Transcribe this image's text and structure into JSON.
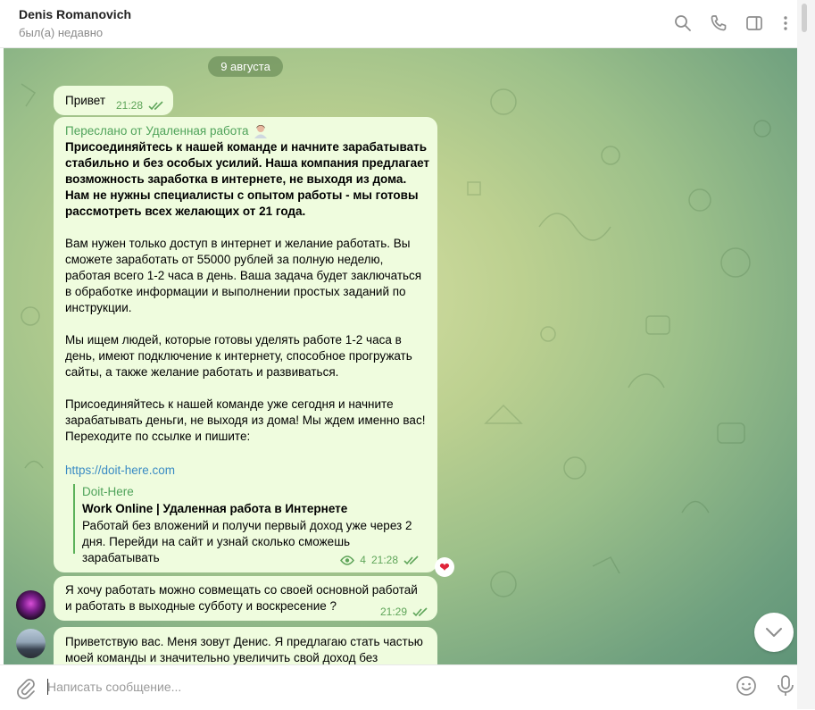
{
  "header": {
    "name": "Denis Romanovich",
    "status": "был(а) недавно",
    "icons": [
      "search-icon",
      "phone-icon",
      "sidebar-toggle-icon",
      "more-vertical-icon"
    ]
  },
  "chat": {
    "date_label": "9 августа",
    "messages": [
      {
        "text": "Привет",
        "time": "21:28"
      },
      {
        "forwarded_from": "Переслано от Удаленная работа",
        "bold_text": "Присоединяйтесь к нашей команде и начните зарабатывать стабильно и без особых усилий. Наша компания предлагает возможность заработка в интернете, не выходя из дома. Нам не нужны специалисты с опытом работы - мы готовы рассмотреть всех желающих от 21 года.",
        "paragraphs": [
          "Вам нужен только доступ в интернет и желание работать. Вы сможете заработать от 55000 рублей за полную неделю, работая всего 1-2 часа в день. Ваша задача будет заключаться в обработке информации и выполнении простых заданий по инструкции.",
          "Мы ищем людей, которые готовы уделять работе 1-2 часа в день, имеют подключение к интернету, способное прогружать сайты, а также желание работать и развиваться.",
          "Присоединяйтесь к нашей команде уже сегодня и начните зарабатывать деньги, не выходя из дома! Мы ждем именно вас! Переходите по ссылке и пишите:"
        ],
        "link": "https://doit-here.com",
        "preview": {
          "site": "Doit-Here",
          "title": "Work Online | Удаленная работа в Интернете",
          "description": "Работай без вложений и получи первый доход уже через 2 дня. Перейди на сайт и узнай сколько сможешь зарабатывать"
        },
        "views": "4",
        "time": "21:28",
        "reaction": "❤"
      },
      {
        "text": "Я хочу работать можно совмещать со своей основной работай и работать в выходные субботу и воскресение ?",
        "time": "21:29"
      },
      {
        "text": "Приветствую вас. Меня зовут Денис. Я предлагаю стать частью моей команды и значительно увеличить свой доход без"
      }
    ]
  },
  "composer": {
    "placeholder": "Написать сообщение..."
  },
  "colors": {
    "bubble": "#effcde",
    "accent_green": "#4fa35a",
    "link": "#3a8bc4"
  }
}
